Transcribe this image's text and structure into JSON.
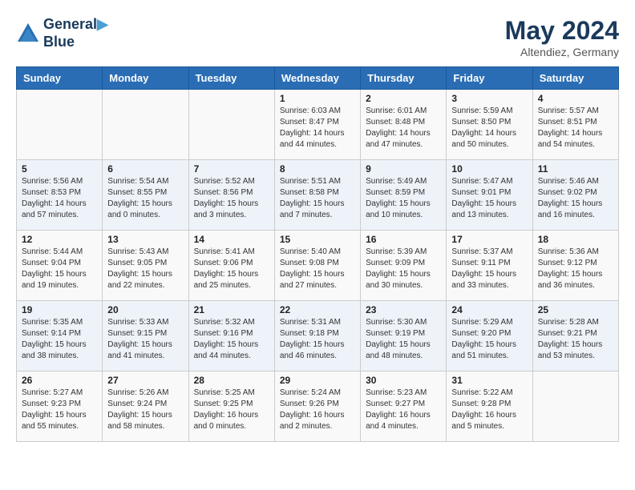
{
  "header": {
    "logo_line1": "General",
    "logo_line2": "Blue",
    "month": "May 2024",
    "location": "Altendiez, Germany"
  },
  "weekdays": [
    "Sunday",
    "Monday",
    "Tuesday",
    "Wednesday",
    "Thursday",
    "Friday",
    "Saturday"
  ],
  "weeks": [
    [
      {
        "day": "",
        "info": ""
      },
      {
        "day": "",
        "info": ""
      },
      {
        "day": "",
        "info": ""
      },
      {
        "day": "1",
        "info": "Sunrise: 6:03 AM\nSunset: 8:47 PM\nDaylight: 14 hours\nand 44 minutes."
      },
      {
        "day": "2",
        "info": "Sunrise: 6:01 AM\nSunset: 8:48 PM\nDaylight: 14 hours\nand 47 minutes."
      },
      {
        "day": "3",
        "info": "Sunrise: 5:59 AM\nSunset: 8:50 PM\nDaylight: 14 hours\nand 50 minutes."
      },
      {
        "day": "4",
        "info": "Sunrise: 5:57 AM\nSunset: 8:51 PM\nDaylight: 14 hours\nand 54 minutes."
      }
    ],
    [
      {
        "day": "5",
        "info": "Sunrise: 5:56 AM\nSunset: 8:53 PM\nDaylight: 14 hours\nand 57 minutes."
      },
      {
        "day": "6",
        "info": "Sunrise: 5:54 AM\nSunset: 8:55 PM\nDaylight: 15 hours\nand 0 minutes."
      },
      {
        "day": "7",
        "info": "Sunrise: 5:52 AM\nSunset: 8:56 PM\nDaylight: 15 hours\nand 3 minutes."
      },
      {
        "day": "8",
        "info": "Sunrise: 5:51 AM\nSunset: 8:58 PM\nDaylight: 15 hours\nand 7 minutes."
      },
      {
        "day": "9",
        "info": "Sunrise: 5:49 AM\nSunset: 8:59 PM\nDaylight: 15 hours\nand 10 minutes."
      },
      {
        "day": "10",
        "info": "Sunrise: 5:47 AM\nSunset: 9:01 PM\nDaylight: 15 hours\nand 13 minutes."
      },
      {
        "day": "11",
        "info": "Sunrise: 5:46 AM\nSunset: 9:02 PM\nDaylight: 15 hours\nand 16 minutes."
      }
    ],
    [
      {
        "day": "12",
        "info": "Sunrise: 5:44 AM\nSunset: 9:04 PM\nDaylight: 15 hours\nand 19 minutes."
      },
      {
        "day": "13",
        "info": "Sunrise: 5:43 AM\nSunset: 9:05 PM\nDaylight: 15 hours\nand 22 minutes."
      },
      {
        "day": "14",
        "info": "Sunrise: 5:41 AM\nSunset: 9:06 PM\nDaylight: 15 hours\nand 25 minutes."
      },
      {
        "day": "15",
        "info": "Sunrise: 5:40 AM\nSunset: 9:08 PM\nDaylight: 15 hours\nand 27 minutes."
      },
      {
        "day": "16",
        "info": "Sunrise: 5:39 AM\nSunset: 9:09 PM\nDaylight: 15 hours\nand 30 minutes."
      },
      {
        "day": "17",
        "info": "Sunrise: 5:37 AM\nSunset: 9:11 PM\nDaylight: 15 hours\nand 33 minutes."
      },
      {
        "day": "18",
        "info": "Sunrise: 5:36 AM\nSunset: 9:12 PM\nDaylight: 15 hours\nand 36 minutes."
      }
    ],
    [
      {
        "day": "19",
        "info": "Sunrise: 5:35 AM\nSunset: 9:14 PM\nDaylight: 15 hours\nand 38 minutes."
      },
      {
        "day": "20",
        "info": "Sunrise: 5:33 AM\nSunset: 9:15 PM\nDaylight: 15 hours\nand 41 minutes."
      },
      {
        "day": "21",
        "info": "Sunrise: 5:32 AM\nSunset: 9:16 PM\nDaylight: 15 hours\nand 44 minutes."
      },
      {
        "day": "22",
        "info": "Sunrise: 5:31 AM\nSunset: 9:18 PM\nDaylight: 15 hours\nand 46 minutes."
      },
      {
        "day": "23",
        "info": "Sunrise: 5:30 AM\nSunset: 9:19 PM\nDaylight: 15 hours\nand 48 minutes."
      },
      {
        "day": "24",
        "info": "Sunrise: 5:29 AM\nSunset: 9:20 PM\nDaylight: 15 hours\nand 51 minutes."
      },
      {
        "day": "25",
        "info": "Sunrise: 5:28 AM\nSunset: 9:21 PM\nDaylight: 15 hours\nand 53 minutes."
      }
    ],
    [
      {
        "day": "26",
        "info": "Sunrise: 5:27 AM\nSunset: 9:23 PM\nDaylight: 15 hours\nand 55 minutes."
      },
      {
        "day": "27",
        "info": "Sunrise: 5:26 AM\nSunset: 9:24 PM\nDaylight: 15 hours\nand 58 minutes."
      },
      {
        "day": "28",
        "info": "Sunrise: 5:25 AM\nSunset: 9:25 PM\nDaylight: 16 hours\nand 0 minutes."
      },
      {
        "day": "29",
        "info": "Sunrise: 5:24 AM\nSunset: 9:26 PM\nDaylight: 16 hours\nand 2 minutes."
      },
      {
        "day": "30",
        "info": "Sunrise: 5:23 AM\nSunset: 9:27 PM\nDaylight: 16 hours\nand 4 minutes."
      },
      {
        "day": "31",
        "info": "Sunrise: 5:22 AM\nSunset: 9:28 PM\nDaylight: 16 hours\nand 5 minutes."
      },
      {
        "day": "",
        "info": ""
      }
    ]
  ]
}
